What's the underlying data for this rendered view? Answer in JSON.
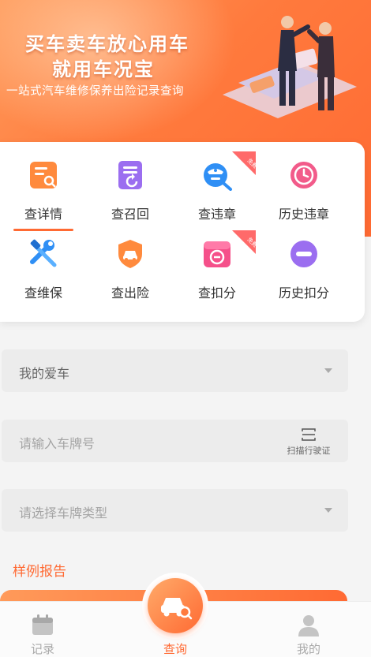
{
  "banner": {
    "title_line1": "买车卖车放心用车",
    "title_line2": "就用车况宝",
    "subtitle": "一站式汽车维修保养出险记录查询"
  },
  "services": [
    {
      "label": "查详情",
      "icon": "report-search-icon",
      "active": true
    },
    {
      "label": "查召回",
      "icon": "recall-doc-icon"
    },
    {
      "label": "查违章",
      "icon": "police-search-icon",
      "badge": "免费"
    },
    {
      "label": "历史违章",
      "icon": "clock-icon"
    },
    {
      "label": "查维保",
      "icon": "wrench-hammer-icon"
    },
    {
      "label": "查出险",
      "icon": "car-shield-icon"
    },
    {
      "label": "查扣分",
      "icon": "minus-box-icon",
      "badge": "免费"
    },
    {
      "label": "历史扣分",
      "icon": "minus-circle-icon"
    }
  ],
  "form": {
    "my_car": "我的爱车",
    "plate_placeholder": "请输入车牌号",
    "scan_label": "扫描行驶证",
    "plate_type_placeholder": "请选择车牌类型"
  },
  "sample_report_title": "样例报告",
  "nav": {
    "records": "记录",
    "query": "查询",
    "mine": "我的"
  },
  "colors": {
    "accent": "#ff6a33",
    "banner_start": "#ff9a5a"
  }
}
